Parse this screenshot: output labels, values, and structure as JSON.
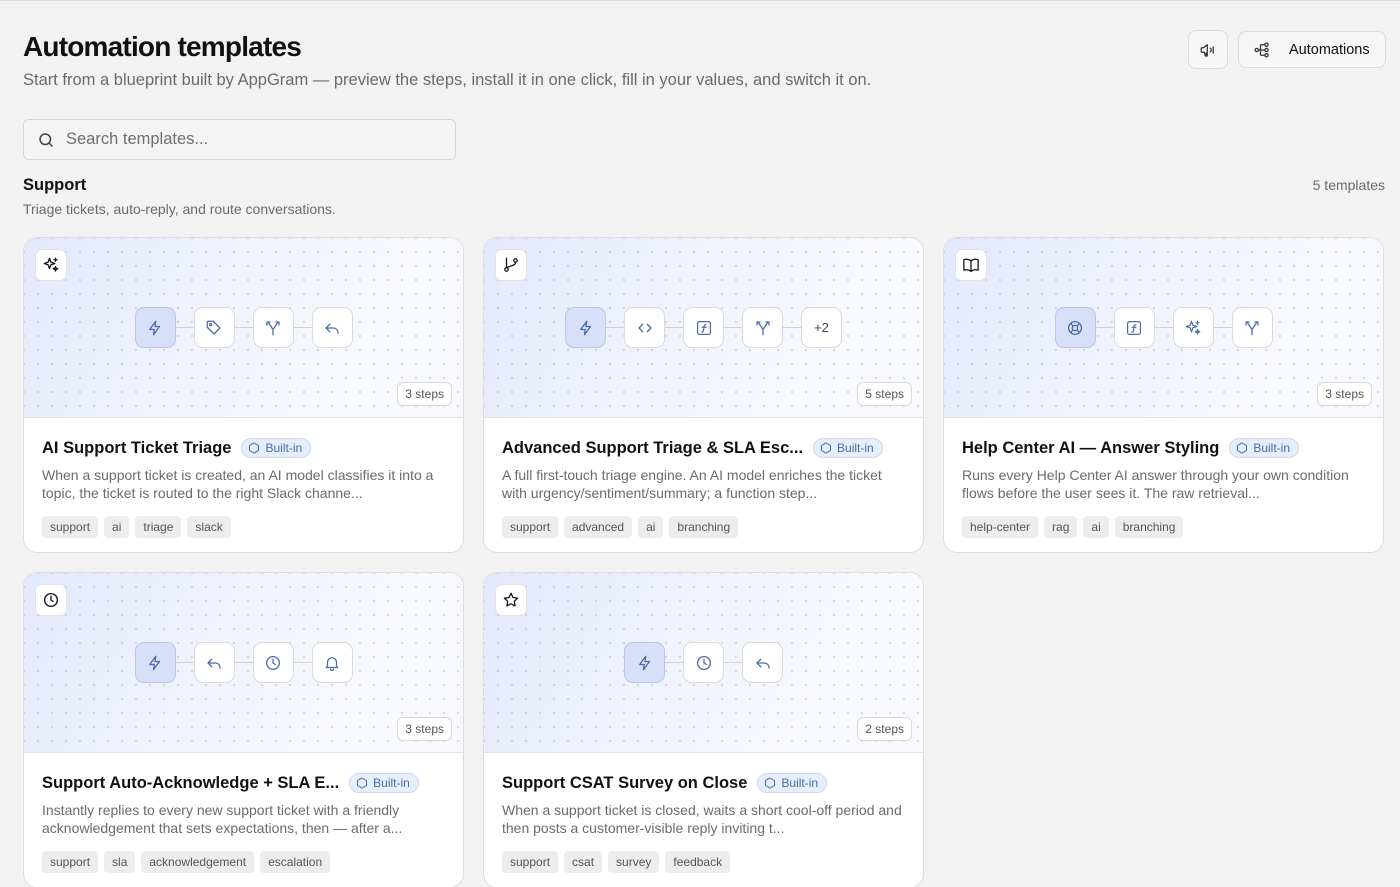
{
  "header": {
    "title": "Automation templates",
    "subtitle": "Start from a blueprint built by AppGram — preview the steps, install it in one click, fill in your values, and switch it on.",
    "automations_label": "Automations"
  },
  "search": {
    "placeholder": "Search templates...",
    "value": ""
  },
  "section": {
    "title": "Support",
    "description": "Triage tickets, auto-reply, and route conversations.",
    "count": "5 templates"
  },
  "badge_label": "Built-in",
  "cards": [
    {
      "title": "AI Support Ticket Triage",
      "description": "When a support ticket is created, an AI model classifies it into a topic, the ticket is routed to the right Slack channe...",
      "steps": "3 steps",
      "icon": "sparkles-icon",
      "nodes": [
        "bolt-icon",
        "tag-icon",
        "branch-icon",
        "reply-icon"
      ],
      "tags": [
        "support",
        "ai",
        "triage",
        "slack"
      ]
    },
    {
      "title": "Advanced Support Triage & SLA Esc...",
      "description": "A full first-touch triage engine. An AI model enriches the ticket with urgency/sentiment/summary; a function step...",
      "steps": "5 steps",
      "icon": "git-branch-icon",
      "nodes": [
        "bolt-icon",
        "code-icon",
        "function-icon",
        "branch-icon"
      ],
      "more": "+2",
      "tags": [
        "support",
        "advanced",
        "ai",
        "branching"
      ]
    },
    {
      "title": "Help Center AI — Answer Styling",
      "description": "Runs every Help Center AI answer through your own condition flows before the user sees it. The raw retrieval...",
      "steps": "3 steps",
      "icon": "book-icon",
      "nodes": [
        "lifebuoy-icon",
        "function-icon",
        "sparkles-icon",
        "branch-icon"
      ],
      "tags": [
        "help-center",
        "rag",
        "ai",
        "branching"
      ]
    },
    {
      "title": "Support Auto-Acknowledge + SLA E...",
      "description": "Instantly replies to every new support ticket with a friendly acknowledgement that sets expectations, then — after a...",
      "steps": "3 steps",
      "icon": "clock-icon",
      "nodes": [
        "bolt-icon",
        "reply-icon",
        "clock-icon",
        "bell-icon"
      ],
      "tags": [
        "support",
        "sla",
        "acknowledgement",
        "escalation"
      ]
    },
    {
      "title": "Support CSAT Survey on Close",
      "description": "When a support ticket is closed, waits a short cool-off period and then posts a customer-visible reply inviting t...",
      "steps": "2 steps",
      "icon": "star-icon",
      "nodes": [
        "bolt-icon",
        "clock-icon",
        "reply-icon"
      ],
      "tags": [
        "support",
        "csat",
        "survey",
        "feedback"
      ]
    }
  ],
  "colors": {
    "accent": "#4d6aa8",
    "trigger_node_bg": "#d7e0f8",
    "badge_bg": "#e6edfb",
    "page_bg": "#f2f2f2"
  }
}
